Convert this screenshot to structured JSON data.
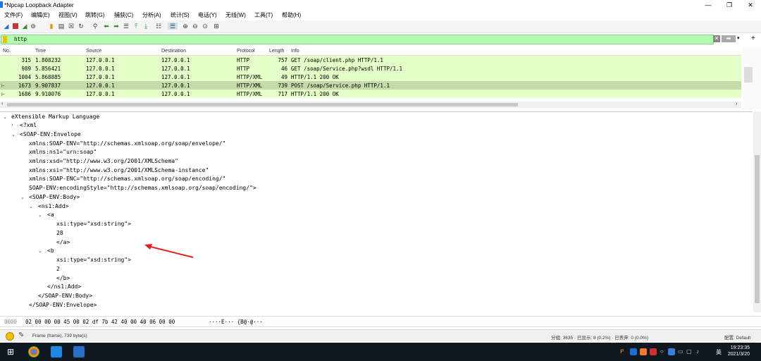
{
  "window": {
    "title": "*Npcap Loopback Adapter"
  },
  "menu": [
    "文件(F)",
    "编辑(E)",
    "视图(V)",
    "跳转(G)",
    "捕获(C)",
    "分析(A)",
    "统计(S)",
    "电话(Y)",
    "无线(W)",
    "工具(T)",
    "帮助(H)"
  ],
  "filter": {
    "value": "http"
  },
  "packet_list": {
    "columns": [
      "No.",
      "Time",
      "Source",
      "Destination",
      "Protocol",
      "Length",
      "Info"
    ],
    "rows": [
      {
        "no": "315",
        "time": "1.808232",
        "src": "127.0.0.1",
        "dst": "127.0.0.1",
        "proto": "HTTP",
        "len": "757",
        "info": "GET /soap/client.php HTTP/1.1"
      },
      {
        "no": "989",
        "time": "5.856421",
        "src": "127.0.0.1",
        "dst": "127.0.0.1",
        "proto": "HTTP",
        "len": "46",
        "info": "GET /soap/Service.php?wsdl HTTP/1.1"
      },
      {
        "no": "1004",
        "time": "5.868885",
        "src": "127.0.0.1",
        "dst": "127.0.0.1",
        "proto": "HTTP/XML",
        "len": "49",
        "info": "HTTP/1.1 200 OK"
      },
      {
        "no": "1673",
        "time": "9.907837",
        "src": "127.0.0.1",
        "dst": "127.0.0.1",
        "proto": "HTTP/XML",
        "len": "739",
        "info": "POST /soap/Service.php HTTP/1.1"
      },
      {
        "no": "1686",
        "time": "9.910076",
        "src": "127.0.0.1",
        "dst": "127.0.0.1",
        "proto": "HTTP/XML",
        "len": "717",
        "info": "HTTP/1.1 200 OK"
      }
    ]
  },
  "details": {
    "lines": [
      "eXtensible Markup Language",
      "<?xml",
      "<SOAP-ENV:Envelope",
      "xmlns:SOAP-ENV=\"http://schemas.xmlsoap.org/soap/envelope/\"",
      "xmlns:ns1=\"urn:soap\"",
      "xmlns:xsd=\"http://www.w3.org/2001/XMLSchema\"",
      "xmlns:xsi=\"http://www.w3.org/2001/XMLSchema-instance\"",
      "xmlns:SOAP-ENC=\"http://schemas.xmlsoap.org/soap/encoding/\"",
      "SOAP-ENV:encodingStyle=\"http://schemas.xmlsoap.org/soap/encoding/\">",
      "<SOAP-ENV:Body>",
      "<ns1:Add>",
      "<a",
      "xsi:type=\"xsd:string\">",
      "28",
      "</a>",
      "<b",
      "xsi:type=\"xsd:string\">",
      "2",
      "</b>",
      "</ns1:Add>",
      "</SOAP-ENV:Body>",
      "</SOAP-ENV:Envelope>"
    ]
  },
  "bytes": {
    "offset": "0000",
    "hex": "02 00 00 00 45 00 02 df  7b 42 40 00 40 06 00 00",
    "ascii": "····E··· {B@·@···"
  },
  "status": {
    "frame": "Frame (frame), 739 byte(s)",
    "stats": "分组: 3635 · 已显示: 8 (0.2%) · 已丢弃: 0 (0.0%)",
    "profile": "配置: Default"
  },
  "taskbar": {
    "time": "19:23:35",
    "date": "2021/3/20",
    "lang": "英"
  },
  "colors": {
    "row_bg": "#e4ffc7",
    "selected_row": "#c6d9a8",
    "filter_bg": "#afffaf",
    "arrow": "#e02020"
  }
}
